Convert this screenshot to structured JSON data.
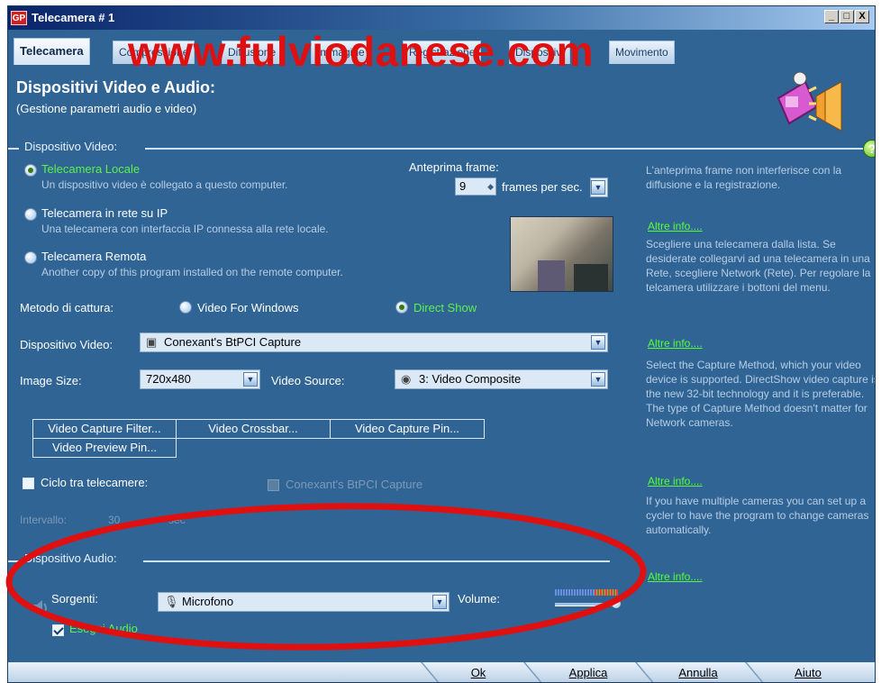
{
  "window": {
    "title": "Telecamera # 1",
    "app_icon_text": "GP",
    "buttons": [
      "_",
      "□",
      "X"
    ]
  },
  "watermark": "www.fulviodanese.com",
  "tabs": [
    {
      "label": "Telecamera",
      "active": true
    },
    {
      "label": "Compressione",
      "active": false
    },
    {
      "label": "Diffusione",
      "active": false
    },
    {
      "label": "Immagine",
      "active": false
    },
    {
      "label": "Registrazione",
      "active": false
    },
    {
      "label": "Dispositivi",
      "active": false
    },
    {
      "label": "Movimento",
      "active": false
    }
  ],
  "header": {
    "title": "Dispositivi Video e Audio:",
    "subtitle": "(Gestione parametri audio e video)"
  },
  "video_section": {
    "title": "Dispositivo Video:",
    "options": [
      {
        "label": "Telecamera Locale",
        "desc": "Un dispositivo video è collegato a questo computer.",
        "selected": true
      },
      {
        "label": "Telecamera in rete su IP",
        "desc": "Una telecamera con interfaccia IP connessa alla rete locale.",
        "selected": false
      },
      {
        "label": "Telecamera Remota",
        "desc": "Another copy of this program installed on the remote computer.",
        "selected": false
      }
    ],
    "preview_frame": {
      "label": "Anteprima frame:",
      "value": "9",
      "unit": "frames per sec."
    },
    "capture_method": {
      "label": "Metodo di cattura:",
      "options": [
        {
          "label": "Video For Windows",
          "selected": false
        },
        {
          "label": "Direct Show",
          "selected": true
        }
      ]
    },
    "video_device": {
      "label": "Dispositivo Video:",
      "value": "Conexant's BtPCI Capture"
    },
    "image_size": {
      "label": "Image Size:",
      "value": "720x480"
    },
    "video_source": {
      "label": "Video Source:",
      "value": "3: Video Composite"
    },
    "buttons": [
      "Video Capture Filter...",
      "Video Crossbar...",
      "Video Capture Pin...",
      "Video Preview Pin..."
    ],
    "cycle": {
      "label": "Ciclo tra telecamere:",
      "checked": false,
      "camera_label": "Conexant's BtPCI Capture"
    },
    "interval": {
      "label": "Intervallo:",
      "value": "30",
      "unit": "sec"
    }
  },
  "audio_section": {
    "title": "Dispositivo Audio:",
    "sources_label": "Sorgenti:",
    "source_value": "Microfono",
    "volume_label": "Volume:",
    "volume_level": 0.95,
    "play_audio": {
      "label": "Esegui Audio",
      "checked": true
    }
  },
  "info_panel": {
    "text1": "L'anteprima frame non interferisce con la diffusione e la registrazione.",
    "link1": "Altre info....",
    "text2": "Scegliere una telecamera dalla lista. Se desiderate collegarvi ad una telecamera in una Rete, scegliere Network (Rete). Per regolare la telcamera utilizzare i bottoni del menu.",
    "link2": "Altre info....",
    "text3": "Select the Capture Method, which your video device is supported. DirectShow video capture is the new 32-bit technology and it is preferable. The type of Capture Method doesn't matter for Network cameras.",
    "link3": "Altre info....",
    "text4": "If you have multiple cameras you can set up a cycler to have the program to change cameras automatically.",
    "link4": "Altre info...."
  },
  "footer": {
    "ok": "Ok",
    "apply": "Applica",
    "cancel": "Annulla",
    "help": "Aiuto"
  },
  "colors": {
    "panel": "#2f6495",
    "accent_green": "#5cf24a",
    "watermark_red": "#e01010",
    "annotation_red": "#e01010"
  }
}
